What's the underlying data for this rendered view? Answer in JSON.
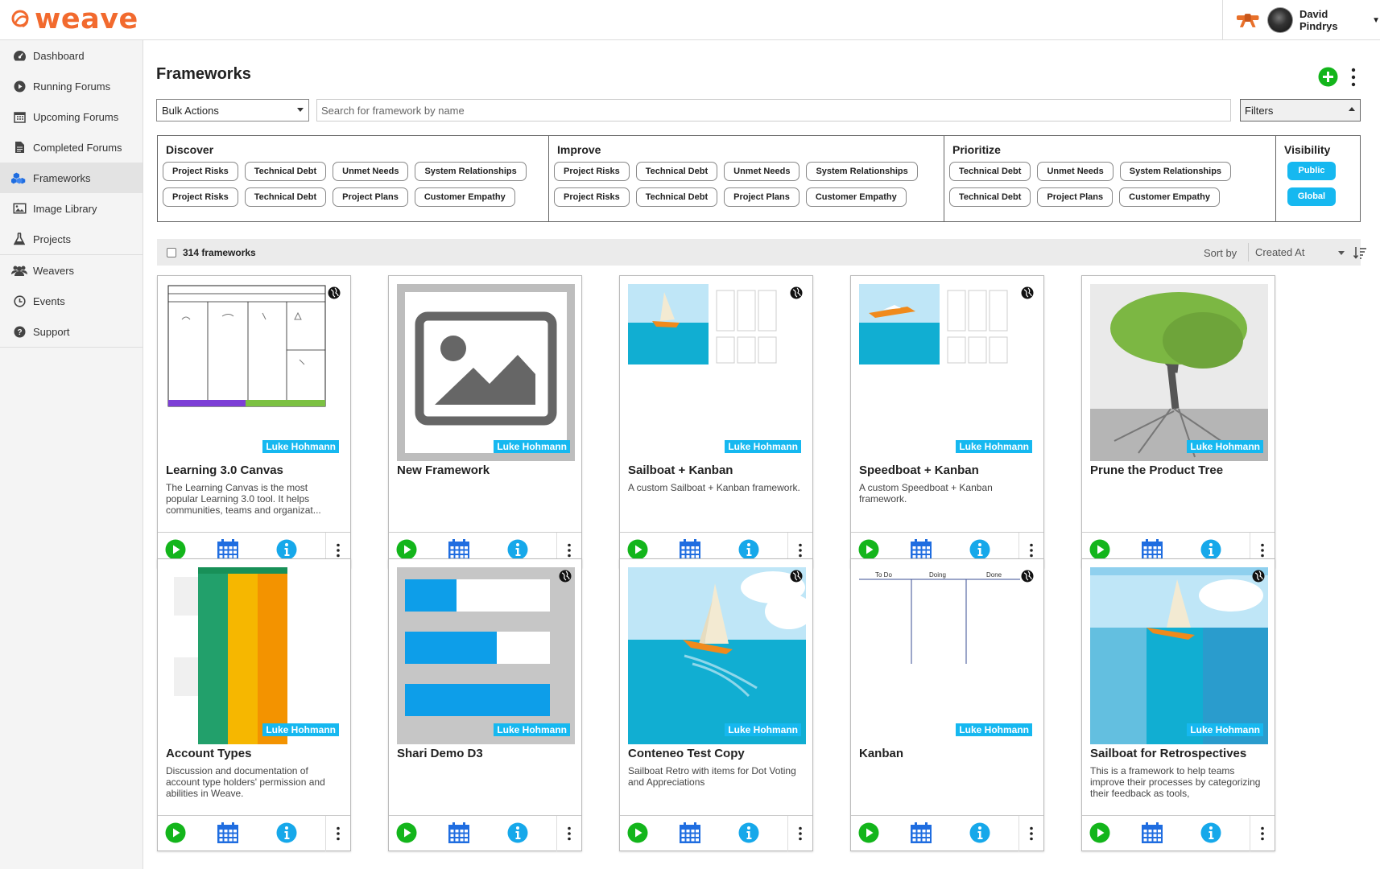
{
  "app": {
    "logo": "weave",
    "user_name": "David Pindrys"
  },
  "sidebar": {
    "items": [
      {
        "label": "Dashboard",
        "icon": "dashboard-icon"
      },
      {
        "label": "Running Forums",
        "icon": "play-circle-icon"
      },
      {
        "label": "Upcoming Forums",
        "icon": "calendar-icon"
      },
      {
        "label": "Completed Forums",
        "icon": "document-icon"
      },
      {
        "label": "Frameworks",
        "icon": "cubes-icon",
        "active": true
      },
      {
        "label": "Image Library",
        "icon": "image-icon"
      },
      {
        "label": "Projects",
        "icon": "flask-icon"
      },
      {
        "label": "Weavers",
        "icon": "users-icon"
      },
      {
        "label": "Events",
        "icon": "clock-icon"
      },
      {
        "label": "Support",
        "icon": "help-icon"
      }
    ]
  },
  "page": {
    "title": "Frameworks"
  },
  "toolbar": {
    "bulk_actions": "Bulk Actions",
    "search_placeholder": "Search for framework by name",
    "filters_label": "Filters"
  },
  "filters": {
    "discover": {
      "title": "Discover",
      "chips": [
        "Project Risks",
        "Technical Debt",
        "Unmet Needs",
        "System Relationships",
        "Project Risks",
        "Technical Debt",
        "Project Plans",
        "Customer Empathy"
      ]
    },
    "improve": {
      "title": "Improve",
      "chips": [
        "Project Risks",
        "Technical Debt",
        "Unmet Needs",
        "System Relationships",
        "Project Risks",
        "Technical Debt",
        "Project Plans",
        "Customer Empathy"
      ]
    },
    "prioritize": {
      "title": "Prioritize",
      "chips": [
        "Technical Debt",
        "Unmet Needs",
        "System Relationships",
        "Technical Debt",
        "Project Plans",
        "Customer Empathy"
      ]
    },
    "visibility": {
      "title": "Visibility",
      "chips": [
        "Public",
        "Global"
      ]
    }
  },
  "list": {
    "count": "314 frameworks",
    "sort_label": "Sort by",
    "sort_value": "Created At"
  },
  "cards": [
    {
      "title": "Learning 3.0 Canvas",
      "author": "Luke Hohmann",
      "desc": "The Learning Canvas is the most popular Learning 3.0 tool. It helps communities, teams and organizat...",
      "thumb": "canvas",
      "globe": true
    },
    {
      "title": "New Framework",
      "author": "Luke Hohmann",
      "desc": "",
      "thumb": "placeholder",
      "globe": false
    },
    {
      "title": "Sailboat + Kanban",
      "author": "Luke Hohmann",
      "desc": "A custom Sailboat + Kanban framework.",
      "thumb": "sailkanban",
      "globe": true
    },
    {
      "title": "Speedboat + Kanban",
      "author": "Luke Hohmann",
      "desc": "A custom Speedboat + Kanban framework.",
      "thumb": "speedkanban",
      "globe": true
    },
    {
      "title": "Prune the Product Tree",
      "author": "Luke Hohmann",
      "desc": "",
      "thumb": "tree",
      "globe": false
    },
    {
      "title": "Account Types",
      "author": "Luke Hohmann",
      "desc": "Discussion and documentation of account type holders' permission and abilities in Weave.",
      "thumb": "account",
      "globe": false
    },
    {
      "title": "Shari Demo D3",
      "author": "Luke Hohmann",
      "desc": "",
      "thumb": "bars",
      "globe": true
    },
    {
      "title": "Conteneo Test Copy",
      "author": "Luke Hohmann",
      "desc": "Sailboat Retro with items for Dot Voting and Appreciations",
      "thumb": "sailboat",
      "globe": true
    },
    {
      "title": "Kanban",
      "author": "Luke Hohmann",
      "desc": "",
      "thumb": "kanban",
      "globe": true
    },
    {
      "title": "Sailboat for Retrospectives",
      "author": "Luke Hohmann",
      "desc": "This is a framework to help teams improve their processes by categorizing their feedback as tools,",
      "thumb": "sailretro",
      "globe": true
    }
  ],
  "kanban_labels": [
    "To Do",
    "Doing",
    "Done"
  ],
  "colors": {
    "accent": "#16b8f0",
    "brand": "#f26a2e",
    "play": "#13b51b",
    "calendar": "#1f6de0",
    "add": "#13b51b"
  }
}
